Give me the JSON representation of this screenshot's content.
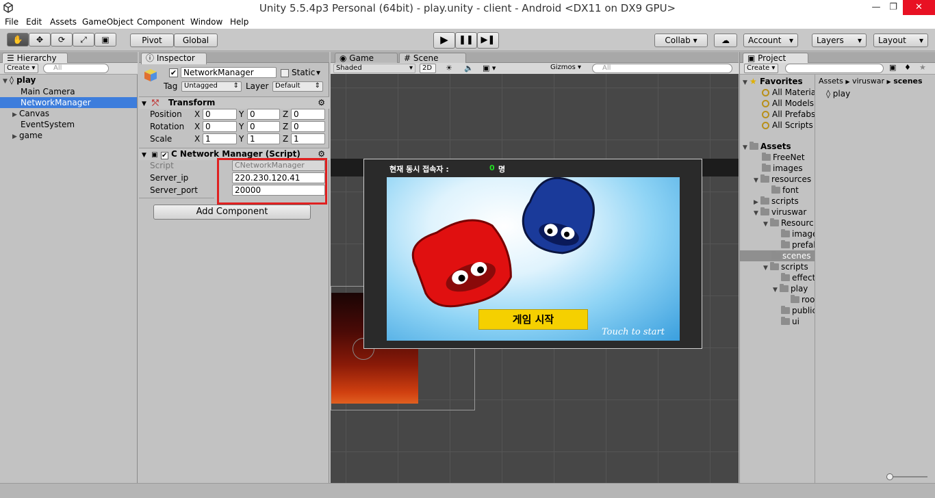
{
  "window": {
    "title": "Unity 5.5.4p3 Personal (64bit) - play.unity - client - Android <DX11 on DX9 GPU>"
  },
  "menu": [
    "File",
    "Edit",
    "Assets",
    "GameObject",
    "Component",
    "Window",
    "Help"
  ],
  "toolbar": {
    "pivot": "Pivot",
    "global": "Global",
    "collab": "Collab ▾",
    "account": "Account",
    "layers": "Layers",
    "layout": "Layout"
  },
  "hierarchy": {
    "tab": "Hierarchy",
    "create": "Create",
    "search": "All",
    "scene": "play",
    "items": [
      "Main Camera",
      "NetworkManager",
      "Canvas",
      "EventSystem",
      "game"
    ]
  },
  "inspector": {
    "tab": "Inspector",
    "name": "NetworkManager",
    "static": "Static",
    "tag_label": "Tag",
    "tag": "Untagged",
    "layer_label": "Layer",
    "layer": "Default",
    "transform": "Transform",
    "position_label": "Position",
    "rotation_label": "Rotation",
    "scale_label": "Scale",
    "position": [
      "0",
      "0",
      "0"
    ],
    "rotation": [
      "0",
      "0",
      "0"
    ],
    "scale": [
      "1",
      "1",
      "1"
    ],
    "axis": [
      "X",
      "Y",
      "Z"
    ],
    "component": "C Network Manager (Script)",
    "script_label": "Script",
    "script": "CNetworkManager",
    "server_ip_label": "Server_ip",
    "server_ip": "220.230.120.41",
    "server_port_label": "Server_port",
    "server_port": "20000",
    "add_component": "Add Component"
  },
  "scene": {
    "game_tab": "Game",
    "scene_tab": "Scene",
    "shading": "Shaded",
    "mode2d": "2D",
    "gizmos": "Gizmos",
    "search": "All",
    "concurrent_label": "현재 동시 접속자 :",
    "concurrent_count": "0",
    "count_unit": "명",
    "start_button": "게임 시작",
    "touch_text": "Touch to start"
  },
  "project": {
    "tab": "Project",
    "create": "Create",
    "favorites": "Favorites",
    "fav_items": [
      "All Materia",
      "All Models",
      "All Prefabs",
      "All Scripts"
    ],
    "assets": "Assets",
    "tree": [
      "FreeNet",
      "images",
      "resources",
      "font",
      "scripts",
      "viruswar",
      "Resourc",
      "image",
      "prefal",
      "scenes",
      "scripts",
      "effect",
      "play",
      "roo",
      "public",
      "ui"
    ],
    "breadcrumb": [
      "Assets",
      "viruswar",
      "scenes"
    ],
    "file": "play"
  },
  "colors": {
    "selection": "#3d7ddc",
    "highlight_box": "#e02020",
    "start_button": "#f5d000",
    "count_green": "#22dd22"
  }
}
